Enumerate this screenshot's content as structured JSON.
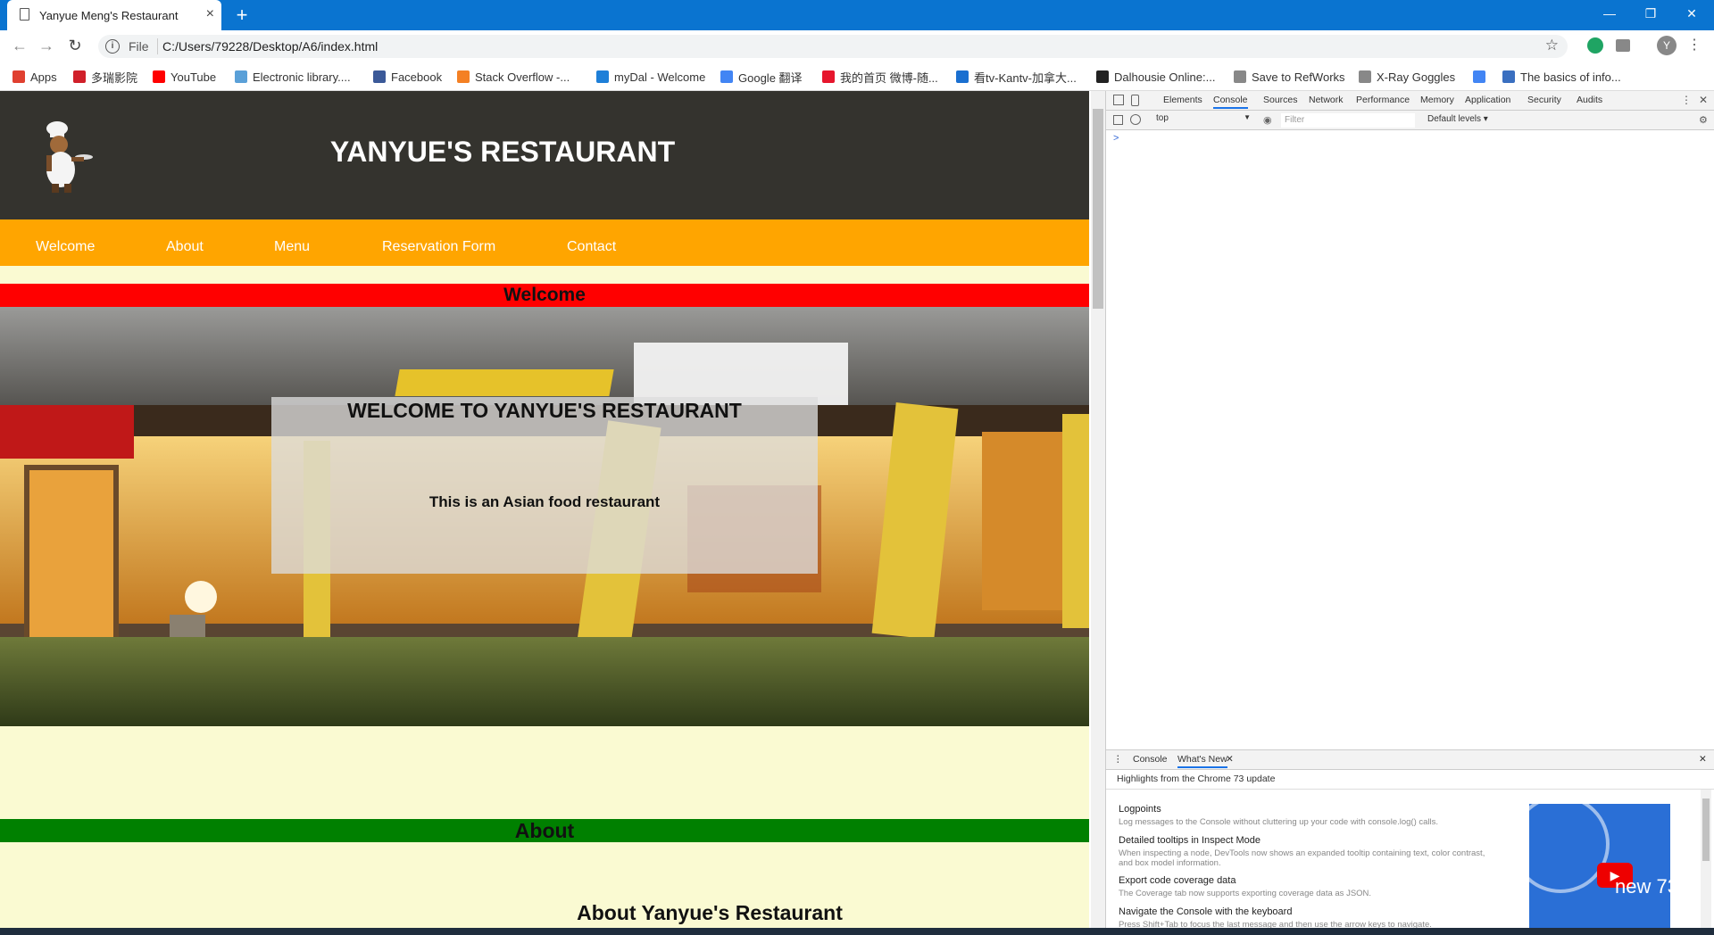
{
  "browser": {
    "tab_title": "Yanyue Meng's Restaurant",
    "tab_close": "×",
    "new_tab": "+",
    "window_controls": [
      "—",
      "❐",
      "✕"
    ],
    "url_scheme_label": "File",
    "url": "C:/Users/79228/Desktop/A6/index.html",
    "profile_initial": "Y",
    "bookmarks": [
      {
        "label": "Apps",
        "icon": "apps-grid-icon",
        "color": "#e04030"
      },
      {
        "label": "多瑞影院",
        "icon": "bookmark-site-icon",
        "color": "#d0202a"
      },
      {
        "label": "YouTube",
        "icon": "youtube-icon",
        "color": "#ff0000"
      },
      {
        "label": "Electronic library....",
        "icon": "bookmark-site-icon",
        "color": "#5aa0d8"
      },
      {
        "label": "Facebook",
        "icon": "facebook-icon",
        "color": "#3b5998"
      },
      {
        "label": "Stack Overflow -...",
        "icon": "stackoverflow-icon",
        "color": "#f48024"
      },
      {
        "label": "myDal - Welcome",
        "icon": "windows-icon",
        "color": "#1e7fd8"
      },
      {
        "label": "Google 翻译",
        "icon": "google-translate-icon",
        "color": "#4285f4"
      },
      {
        "label": "我的首页 微博-随...",
        "icon": "weibo-icon",
        "color": "#e6162d"
      },
      {
        "label": "看tv-Kantv-加拿大...",
        "icon": "kantv-icon",
        "color": "#1a6fd0"
      },
      {
        "label": "Dalhousie Online:...",
        "icon": "dalhousie-icon",
        "color": "#222222"
      },
      {
        "label": "Save to RefWorks",
        "icon": "page-icon",
        "color": "#888888"
      },
      {
        "label": "X-Ray Goggles",
        "icon": "page-icon",
        "color": "#888888"
      },
      {
        "label": "",
        "icon": "google-icon",
        "color": "#4285f4"
      },
      {
        "label": "The basics of info...",
        "icon": "bookmark-site-icon",
        "color": "#3a6fc0"
      }
    ]
  },
  "site": {
    "title": "YANYUE'S RESTAURANT",
    "nav": [
      "Welcome",
      "About",
      "Menu",
      "Reservation Form",
      "Contact"
    ],
    "welcome_section": "Welcome",
    "welcome_heading": "WELCOME TO YANYUE'S RESTAURANT",
    "welcome_text": "This is an Asian food restaurant",
    "about_section": "About",
    "about_heading": "About Yanyue's Restaurant",
    "colors": {
      "header": "#34332e",
      "nav": "#ffa500",
      "welcome_bar": "#ff0000",
      "about_bar": "#008000",
      "background": "#fafad2"
    }
  },
  "devtools": {
    "tabs": [
      "Elements",
      "Console",
      "Sources",
      "Network",
      "Performance",
      "Memory",
      "Application",
      "Security",
      "Audits"
    ],
    "active_tab": "Console",
    "context": "top",
    "filter_placeholder": "Filter",
    "levels": "Default levels",
    "prompt": ">",
    "drawer_tabs": [
      "Console",
      "What's New"
    ],
    "drawer_subtitle": "Highlights from the Chrome 73 update",
    "news": [
      {
        "title": "Logpoints",
        "desc": "Log messages to the Console without cluttering up your code with console.log() calls."
      },
      {
        "title": "Detailed tooltips in Inspect Mode",
        "desc": "When inspecting a node, DevTools now shows an expanded tooltip containing text, color contrast, and box model information."
      },
      {
        "title": "Export code coverage data",
        "desc": "The Coverage tab now supports exporting coverage data as JSON."
      },
      {
        "title": "Navigate the Console with the keyboard",
        "desc": "Press Shift+Tab to focus the last message and then use the arrow keys to navigate."
      }
    ],
    "video_label": "new 73"
  }
}
